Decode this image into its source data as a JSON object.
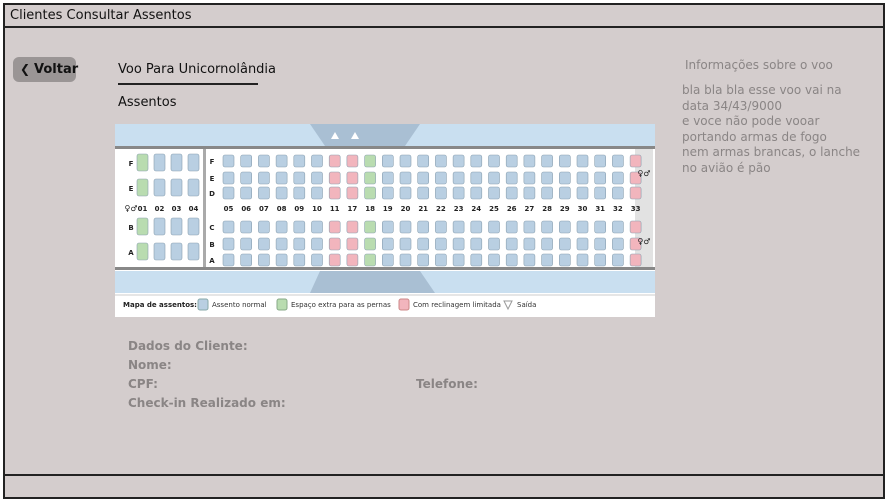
{
  "window": {
    "title": "Clientes Consultar Assentos"
  },
  "nav": {
    "back_label": "Voltar"
  },
  "flight": {
    "title": "Voo Para Unicornolândia",
    "seats_heading": "Assentos"
  },
  "seatmap": {
    "rows_upper": [
      "F",
      "E",
      "D"
    ],
    "rows_lower": [
      "C",
      "B",
      "A"
    ],
    "front_rows_upper": [
      "F",
      "E"
    ],
    "front_rows_lower": [
      "B",
      "A"
    ],
    "front_columns": [
      "01",
      "02",
      "03",
      "04"
    ],
    "columns": [
      "05",
      "06",
      "07",
      "08",
      "09",
      "10",
      "11",
      "17",
      "18",
      "19",
      "20",
      "21",
      "22",
      "23",
      "24",
      "25",
      "26",
      "27",
      "28",
      "29",
      "30",
      "31",
      "32",
      "33"
    ],
    "extra_legroom_columns": [
      "18"
    ],
    "limited_recline_columns": [
      "11",
      "17",
      "33"
    ],
    "legend": {
      "title": "Mapa de assentos:",
      "normal": "Assento normal",
      "extra": "Espaço extra para as pernas",
      "limited": "Com reclinagem limitada",
      "exit": "Saída"
    },
    "colors": {
      "normal": "#b9cfe2",
      "extra": "#b9dcb0",
      "limited": "#f2b5bd",
      "fuselage": "#c9dff0"
    }
  },
  "info": {
    "title": "Informações sobre o voo",
    "body": "bla bla bla esse voo vai na\ndata 34/43/9000\ne voce não pode vooar\nportando armas de fogo\nnem armas brancas, o lanche\nno avião é pão"
  },
  "client": {
    "data_label": "Dados do Cliente:",
    "name_label": "Nome:",
    "cpf_label": "CPF:",
    "phone_label": "Telefone:",
    "checkin_label": "Check-in Realizado em:"
  }
}
